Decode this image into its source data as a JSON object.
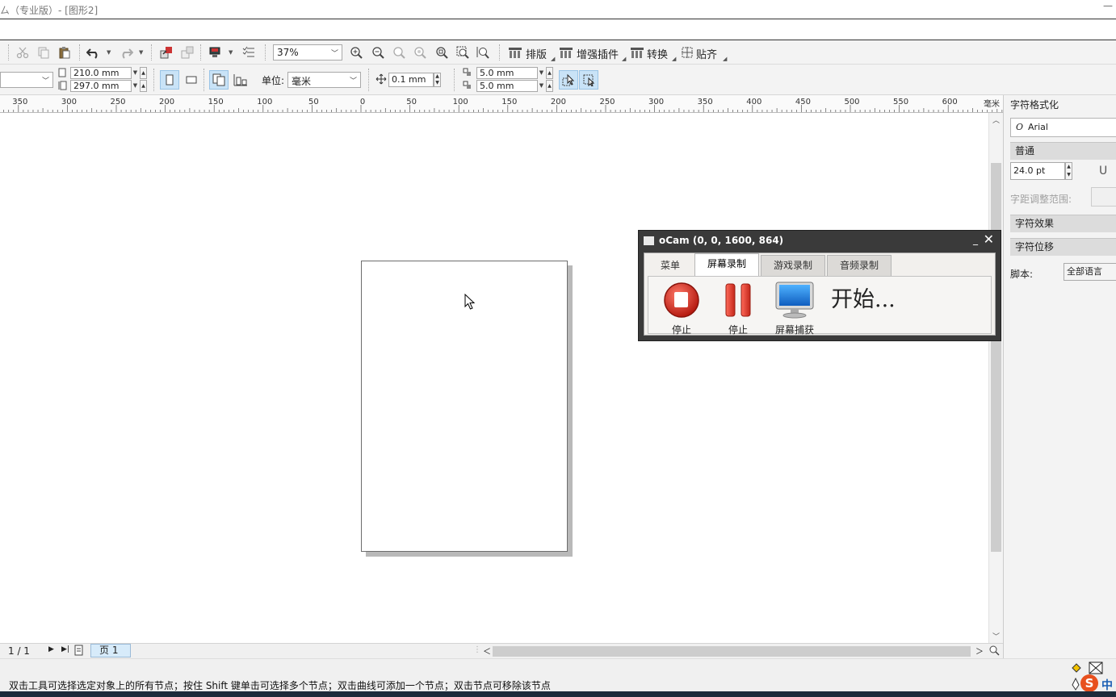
{
  "window": {
    "title": "ㄙ（专业版）- [图形2]",
    "minimize": "—"
  },
  "toolbar1": {
    "zoom": "37%",
    "layout_label": "排版",
    "plugins_label": "增强插件",
    "convert_label": "转换",
    "snap_label": "贴齐",
    "icons": [
      "cut-icon",
      "copy-icon",
      "paste-icon",
      "undo-icon",
      "redo-icon",
      "import-icon",
      "export-icon",
      "publish-icon",
      "options-icon",
      "zoom-in-icon",
      "zoom-out-icon",
      "zoom-selection-icon",
      "zoom-all-icon",
      "zoom-page-icon",
      "zoom-width-icon",
      "zoom-height-icon"
    ]
  },
  "toolbar2": {
    "width": "210.0 mm",
    "height": "297.0 mm",
    "unit_label": "单位:",
    "unit": "毫米",
    "nudge": "0.1 mm",
    "dup_x": "5.0 mm",
    "dup_y": "5.0 mm"
  },
  "ruler": {
    "unit_label": "毫米",
    "ticks": [
      "350",
      "300",
      "250",
      "200",
      "150",
      "100",
      "50",
      "0",
      "50",
      "100",
      "150",
      "200",
      "250",
      "300",
      "350",
      "400",
      "450",
      "500",
      "550",
      "600"
    ]
  },
  "navigation": {
    "page_count": "1 / 1",
    "page_tab": "页 1"
  },
  "status": {
    "message": "双击工具可选择选定对象上的所有节点；按住 Shift 键单击可选择多个节点；双击曲线可添加一个节点；双击节点可移除该节点"
  },
  "docker": {
    "title": "字符格式化",
    "font": "Arial",
    "style": "普通",
    "size": "24.0 pt",
    "kerning_label": "字距调整范围:",
    "effects_label": "字符效果",
    "offset_label": "字符位移",
    "script_label": "脚本:",
    "script_value": "全部语言"
  },
  "ocam": {
    "title": "oCam (0, 0, 1600, 864)",
    "tabs": [
      "菜单",
      "屏幕录制",
      "游戏录制",
      "音频录制"
    ],
    "stop_label": "停止",
    "pause_label": "停止",
    "capture_label": "屏幕捕获",
    "status_text": "开始..."
  },
  "tray": {
    "ime": "中"
  },
  "colors": {
    "accent": "#c9e3f7",
    "ocam_frame": "#3a3a3a",
    "record_red": "#d42a1e"
  }
}
